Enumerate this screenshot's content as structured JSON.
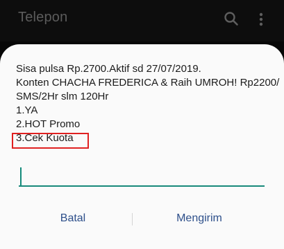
{
  "appbar": {
    "title": "Telepon",
    "search_icon": "search-icon",
    "more_icon": "more-vert-icon"
  },
  "dialog": {
    "message_lines": [
      "Sisa pulsa Rp.2700.Aktif sd 27/07/2019.",
      "Konten CHACHA FREDERICA & Raih UMROH! Rp2200/",
      "SMS/2Hr slm 120Hr",
      "1.YA",
      "2.HOT Promo",
      "3.Cek Kuota"
    ],
    "input_value": "",
    "cancel_label": "Batal",
    "send_label": "Mengirim"
  },
  "colors": {
    "background": "#070707",
    "dialog": "#fafafa",
    "accent": "#17897a",
    "button_text": "#2d4f8a",
    "highlight": "#e02020"
  }
}
